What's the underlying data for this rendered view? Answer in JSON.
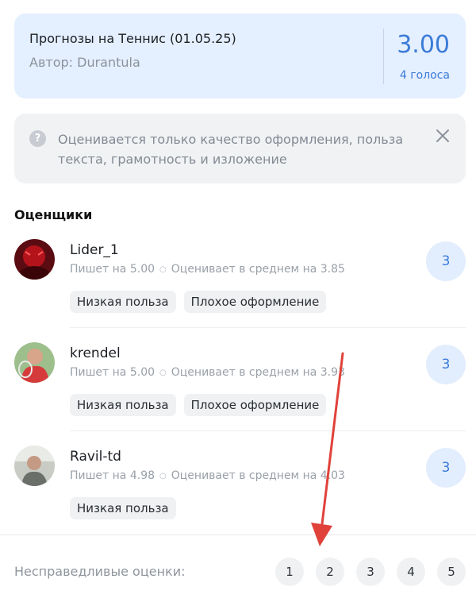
{
  "summary": {
    "title": "Прогнозы на Теннис (01.05.25)",
    "author": "Автор: Durantula",
    "score": "3.00",
    "votes": "4 голоса"
  },
  "notice": {
    "icon": "question-icon",
    "icon_glyph": "?",
    "text": "Оценивается только качество оформления, польза текста, грамотность и изложение",
    "close_icon": "close-icon"
  },
  "raters_title": "Оценщики",
  "raters": [
    {
      "name": "Lider_1",
      "writes": "Пишет на 5.00",
      "rates_avg": "Оценивает в среднем на 3.85",
      "tags": [
        "Низкая польза",
        "Плохое оформление"
      ],
      "grade": "3"
    },
    {
      "name": "krendel",
      "writes": "Пишет на 5.00",
      "rates_avg": "Оценивает в среднем на 3.93",
      "tags": [
        "Низкая польза",
        "Плохое оформление"
      ],
      "grade": "3"
    },
    {
      "name": "Ravil-td",
      "writes": "Пишет на 4.98",
      "rates_avg": "Оценивает в среднем на 4.03",
      "tags": [
        "Низкая польза"
      ],
      "grade": "3"
    }
  ],
  "footer": {
    "label": "Несправедливые оценки:",
    "pages": [
      "1",
      "2",
      "3",
      "4",
      "5"
    ]
  },
  "colors": {
    "accent": "#3b7bd8",
    "summary_bg": "#e4efff",
    "annotation_arrow": "#e0423a"
  }
}
